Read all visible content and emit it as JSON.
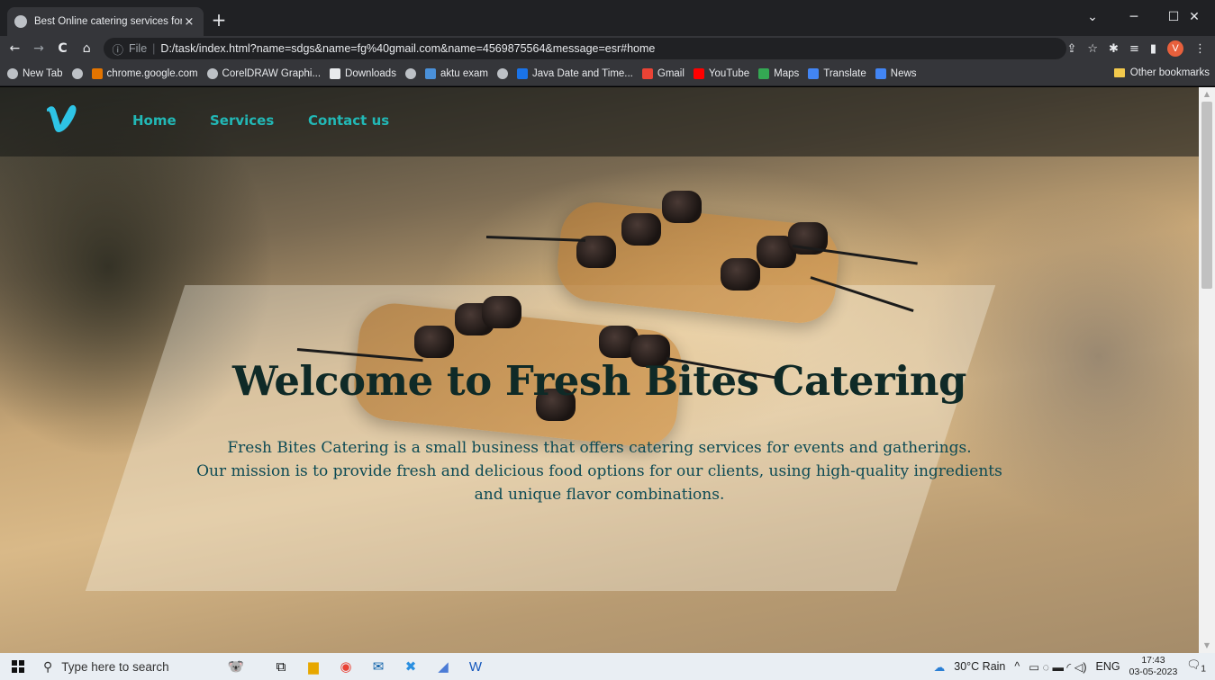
{
  "browser": {
    "tab_title": "Best Online catering services for ",
    "tab_close": "×",
    "new_tab": "+",
    "window_controls": {
      "minimize": "─",
      "maximize": "☐",
      "close": "✕",
      "dropdown": "⌄"
    },
    "nav": {
      "back": "←",
      "forward": "→",
      "reload": "C",
      "home": "⌂"
    },
    "address": {
      "info_icon": "ⓘ",
      "scheme_label": "File",
      "separator": "|",
      "url": "D:/task/index.html?name=sdgs&name=fg%40gmail.com&name=4569875564&message=esr#home"
    },
    "toolbar_icons": {
      "share": "⇪",
      "star": "☆",
      "extensions": "✱",
      "media": "≡",
      "sidepanel": "▮",
      "profile": "V",
      "menu": "⋮"
    },
    "bookmarks": [
      {
        "label": "New Tab",
        "icon": "globe-icon",
        "color": "#bdc1c6"
      },
      {
        "label": "",
        "icon": "globe-icon",
        "color": "#bdc1c6"
      },
      {
        "label": "chrome.google.com",
        "icon": "chrome-store-icon",
        "color": "#e37400"
      },
      {
        "label": "CorelDRAW Graphi...",
        "icon": "globe-icon",
        "color": "#bdc1c6"
      },
      {
        "label": "Downloads",
        "icon": "download-icon",
        "color": "#e8eaed"
      },
      {
        "label": "",
        "icon": "globe-icon",
        "color": "#bdc1c6"
      },
      {
        "label": "aktu exam",
        "icon": "aktu-icon",
        "color": "#4a90d9"
      },
      {
        "label": "",
        "icon": "globe-icon",
        "color": "#bdc1c6"
      },
      {
        "label": "Java Date and Time...",
        "icon": "java-icon",
        "color": "#1a73e8"
      },
      {
        "label": "Gmail",
        "icon": "gmail-icon",
        "color": "#ea4335"
      },
      {
        "label": "YouTube",
        "icon": "youtube-icon",
        "color": "#ff0000"
      },
      {
        "label": "Maps",
        "icon": "maps-icon",
        "color": "#34a853"
      },
      {
        "label": "Translate",
        "icon": "translate-icon",
        "color": "#4285f4"
      },
      {
        "label": "News",
        "icon": "news-icon",
        "color": "#4285f4"
      }
    ],
    "other_bookmarks": "Other bookmarks"
  },
  "page": {
    "logo": "V",
    "nav": {
      "home": "Home",
      "services": "Services",
      "contact": "Contact us"
    },
    "hero": {
      "title": "Welcome to Fresh Bites Catering",
      "line1": "Fresh Bites Catering is a small business that offers catering services for events and gatherings.",
      "line2": "Our mission is to provide fresh and delicious food options for our clients, using high-quality ingredients",
      "line3": "and unique flavor combinations."
    },
    "colors": {
      "accent": "#22b8b6",
      "title": "#0f2a27",
      "body_text": "#0c4a54"
    }
  },
  "taskbar": {
    "search_placeholder": "Type here to search",
    "weather": "30°C  Rain",
    "language": "ENG",
    "time": "17:43",
    "date": "03-05-2023",
    "notification_count": "1"
  }
}
